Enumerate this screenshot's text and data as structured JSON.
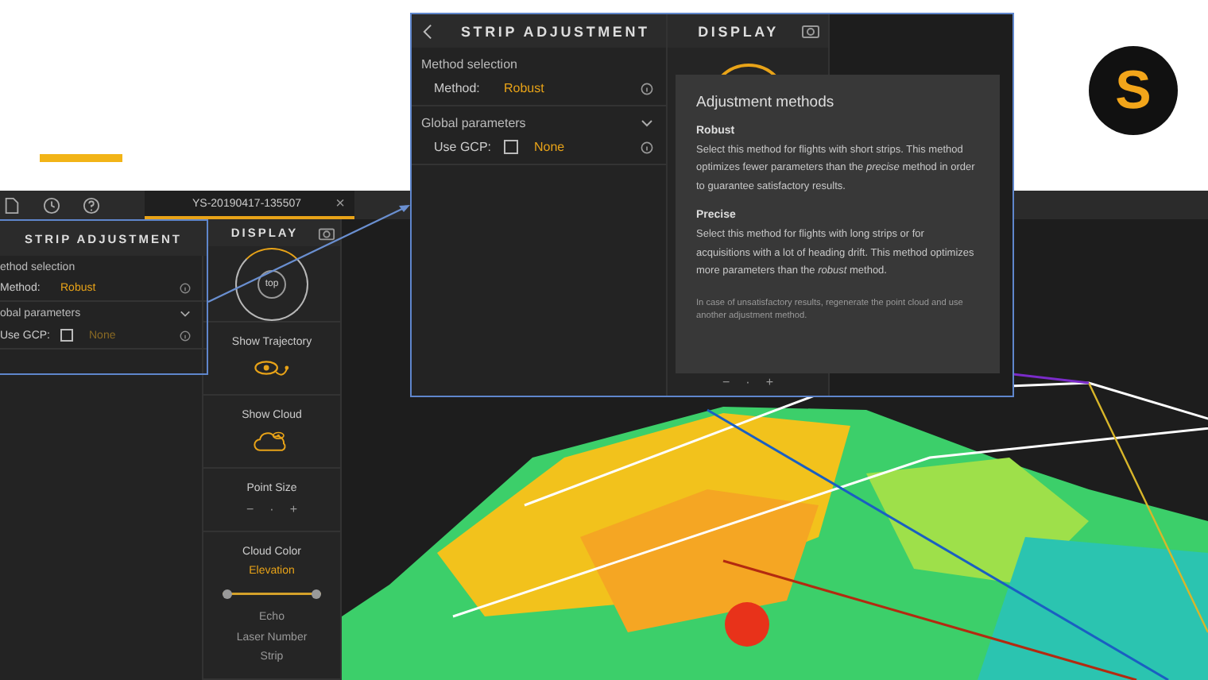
{
  "slide": {
    "logo_letter": "S"
  },
  "toolbar": {
    "tab": {
      "label": "YS-20190417-135507",
      "selected": true,
      "close": "×"
    }
  },
  "strip_panel": {
    "title": "STRIP ADJUSTMENT",
    "sections": [
      {
        "label": "ethod selection",
        "rows": [
          {
            "kind": "select",
            "label": "Method:",
            "value": "Robust"
          }
        ]
      },
      {
        "label": "obal parameters",
        "rows": [
          {
            "kind": "checkbox",
            "label": "Use GCP:",
            "checked": false,
            "value": "None"
          }
        ]
      }
    ]
  },
  "display_panel": {
    "title": "DISPLAY",
    "compass_label": "top",
    "items": [
      {
        "kind": "trajectory",
        "label": "Show Trajectory"
      },
      {
        "kind": "cloud",
        "label": "Show Cloud"
      },
      {
        "kind": "stepper",
        "label": "Point Size",
        "buttons": [
          "−",
          "·",
          "+"
        ]
      },
      {
        "kind": "color",
        "label": "Cloud Color",
        "value": "Elevation",
        "level": 1,
        "options": [
          "Echo",
          "Laser Number",
          "Strip"
        ]
      }
    ]
  },
  "callout": {
    "strip_title": "STRIP ADJUSTMENT",
    "display_title": "DISPLAY",
    "sections": [
      {
        "label": "Method selection",
        "rows": [
          {
            "kind": "select",
            "label": "Method:",
            "value": "Robust"
          }
        ]
      },
      {
        "label": "Global parameters",
        "rows": [
          {
            "kind": "checkbox",
            "label": "Use GCP:",
            "checked": false,
            "value": "None"
          }
        ]
      }
    ],
    "stepper": [
      "−",
      "·",
      "+"
    ],
    "tooltip": {
      "title": "Adjustment methods",
      "blocks": [
        {
          "heading": "Robust",
          "text": "Select this method for flights with short strips. This method optimizes fewer parameters than the *precise* method in order to guarantee satisfactory results."
        },
        {
          "heading": "Precise",
          "text": "Select this method for flights with long strips or for acquisitions with a lot of heading drift. This method optimizes more parameters than the *robust* method."
        }
      ],
      "note": "In case of unsatisfactory results, regenerate the point cloud and use another adjustment method."
    }
  }
}
